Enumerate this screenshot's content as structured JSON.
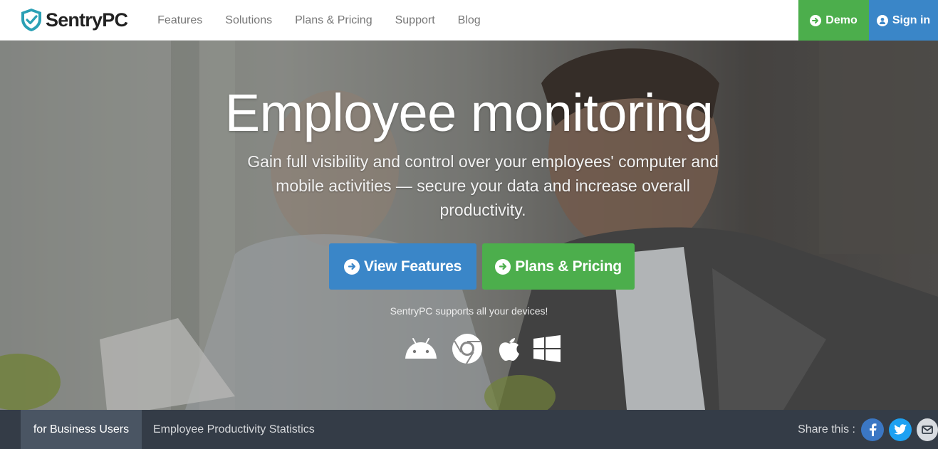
{
  "nav": {
    "brand": "SentryPC",
    "links": [
      "Features",
      "Solutions",
      "Plans & Pricing",
      "Support",
      "Blog"
    ],
    "demo_label": "Demo",
    "signin_label": "Sign in"
  },
  "hero": {
    "title": "Employee monitoring",
    "subtitle": "Gain full visibility and control over your employees' computer and mobile activities — secure your data and increase overall productivity.",
    "btn_features": "View Features",
    "btn_pricing": "Plans & Pricing",
    "devices_text": "SentryPC supports all your devices!",
    "device_icons": [
      "android-icon",
      "chrome-icon",
      "apple-icon",
      "windows-icon"
    ]
  },
  "bottom": {
    "tabs": [
      "for Business Users",
      "Employee Productivity Statistics"
    ],
    "share_label": "Share this :",
    "social_icons": [
      "facebook-icon",
      "twitter-icon",
      "email-icon"
    ]
  },
  "colors": {
    "green": "#4cae4c",
    "blue": "#3a86c8",
    "bottom_bar": "#343c47",
    "active_tab": "#4a5563"
  }
}
